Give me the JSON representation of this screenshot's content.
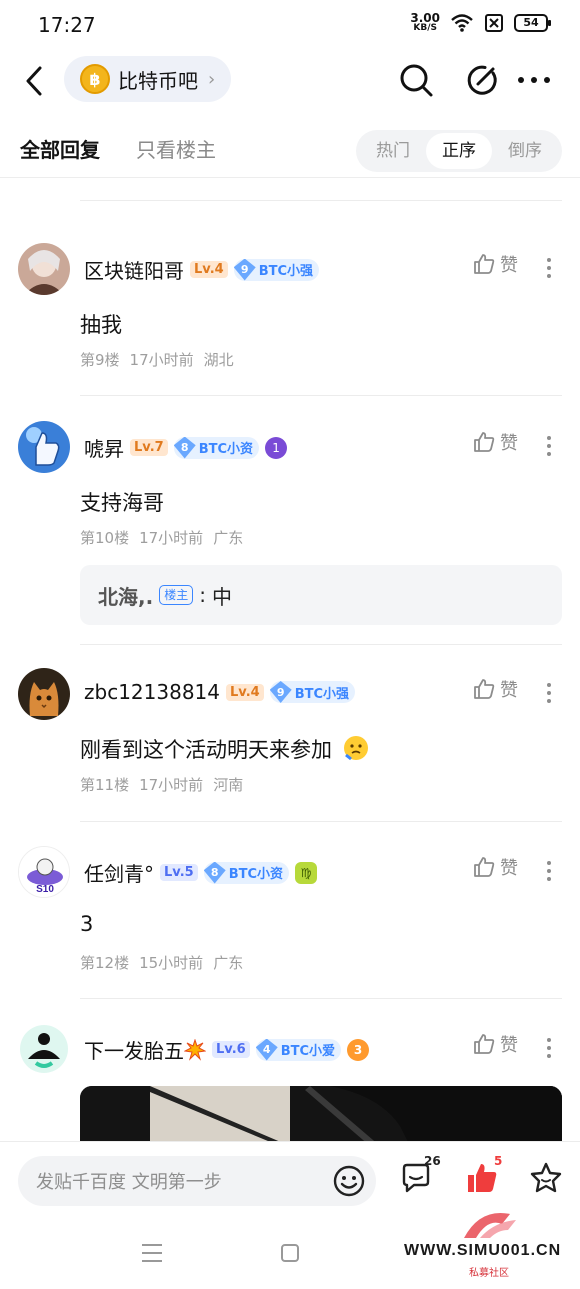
{
  "status": {
    "time": "17:27",
    "speed_value": "3.00",
    "speed_unit": "KB/S",
    "battery": "54"
  },
  "header": {
    "forum_name": "比特币吧",
    "forum_logo_char": "฿"
  },
  "filters": {
    "all_replies": "全部回复",
    "host_only": "只看楼主",
    "sort_hot": "热门",
    "sort_asc": "正序",
    "sort_desc": "倒序",
    "active_sort": "正序"
  },
  "like_label": "赞",
  "posts": [
    {
      "username": "区块链阳哥",
      "level": "Lv.4",
      "title_num": "9",
      "title": "BTC小强",
      "content": "抽我",
      "floor": "第9楼",
      "time": "17小时前",
      "location": "湖北"
    },
    {
      "username": "唬昇",
      "level": "Lv.7",
      "title_num": "8",
      "title": "BTC小资",
      "extra_badge": "1",
      "content": "支持海哥",
      "floor": "第10楼",
      "time": "17小时前",
      "location": "广东",
      "sub_reply": {
        "name": "北海,.",
        "tag": "楼主",
        "text": "中"
      }
    },
    {
      "username": "zbc12138814",
      "level": "Lv.4",
      "title_num": "9",
      "title": "BTC小强",
      "content": "刚看到这个活动明天来参加",
      "floor": "第11楼",
      "time": "17小时前",
      "location": "河南"
    },
    {
      "username": "任剑青°",
      "level": "Lv.5",
      "title_num": "8",
      "title": "BTC小资",
      "extra_badge": "♍",
      "avatar_text": "S10",
      "content": "3",
      "floor": "第12楼",
      "time": "15小时前",
      "location": "广东"
    },
    {
      "username": "下一发胎五",
      "level": "Lv.6",
      "title_num": "4",
      "title": "BTC小爱",
      "extra_badge": "3"
    }
  ],
  "bottom": {
    "input_placeholder": "发贴千百度 文明第一步",
    "comment_count": "26",
    "like_count": "5"
  },
  "watermark": {
    "text": "WWW.SIMU001.CN",
    "sub": "私募社区"
  },
  "colors": {
    "accent_blue": "#3b86ff",
    "like_red": "#ef3d3d",
    "level_orange": "#e07a1f",
    "level_blue": "#4e6ef2"
  }
}
